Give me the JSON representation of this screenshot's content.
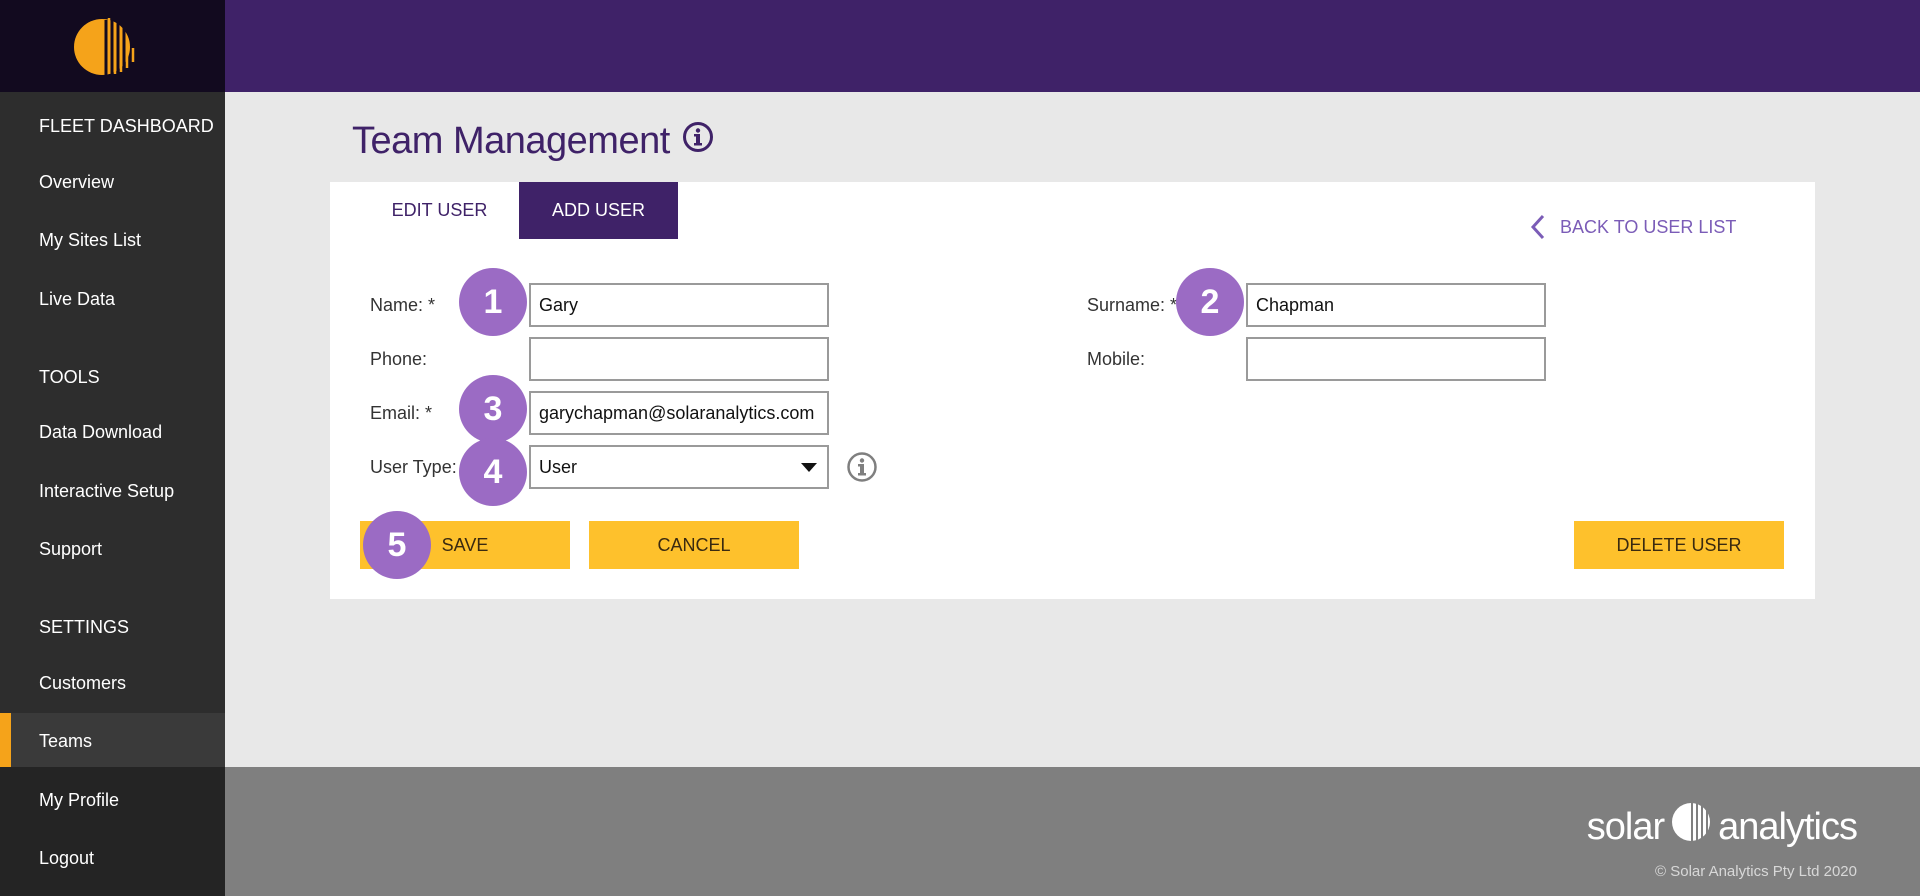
{
  "sidebar": {
    "items": [
      {
        "label": "FLEET DASHBOARD"
      },
      {
        "label": "Overview"
      },
      {
        "label": "My Sites List"
      },
      {
        "label": "Live Data"
      },
      {
        "label": "TOOLS"
      },
      {
        "label": "Data Download"
      },
      {
        "label": "Interactive Setup"
      },
      {
        "label": "Support"
      },
      {
        "label": "SETTINGS"
      },
      {
        "label": "Customers"
      },
      {
        "label": "Teams"
      },
      {
        "label": "My Profile"
      },
      {
        "label": "Logout"
      }
    ],
    "active_item": "Teams"
  },
  "page": {
    "title": "Team Management"
  },
  "tabs": [
    {
      "label": "EDIT USER"
    },
    {
      "label": "ADD USER"
    }
  ],
  "back_link": "BACK TO USER LIST",
  "form": {
    "name_label": "Name: *",
    "name_value": "Gary",
    "surname_label": "Surname: *",
    "surname_value": "Chapman",
    "phone_label": "Phone:",
    "phone_value": "",
    "mobile_label": "Mobile:",
    "mobile_value": "",
    "email_label": "Email: *",
    "email_value": "garychapman@solaranalytics.com",
    "user_type_label": "User Type:",
    "user_type_value": "User"
  },
  "buttons": {
    "save": "SAVE",
    "cancel": "CANCEL",
    "delete": "DELETE USER"
  },
  "badges": [
    "1",
    "2",
    "3",
    "4",
    "5"
  ],
  "footer": {
    "logo_left": "solar",
    "logo_right": "analytics",
    "copyright": "© Solar Analytics Pty Ltd 2020"
  },
  "colors": {
    "brand_purple": "#3f2268",
    "accent_orange": "#f5a31a",
    "button_yellow": "#fec12c",
    "badge_purple": "#9b6bc4"
  },
  "icons": [
    "solar-analytics-logo-icon",
    "info-icon",
    "chevron-left-icon",
    "caret-down-icon"
  ]
}
